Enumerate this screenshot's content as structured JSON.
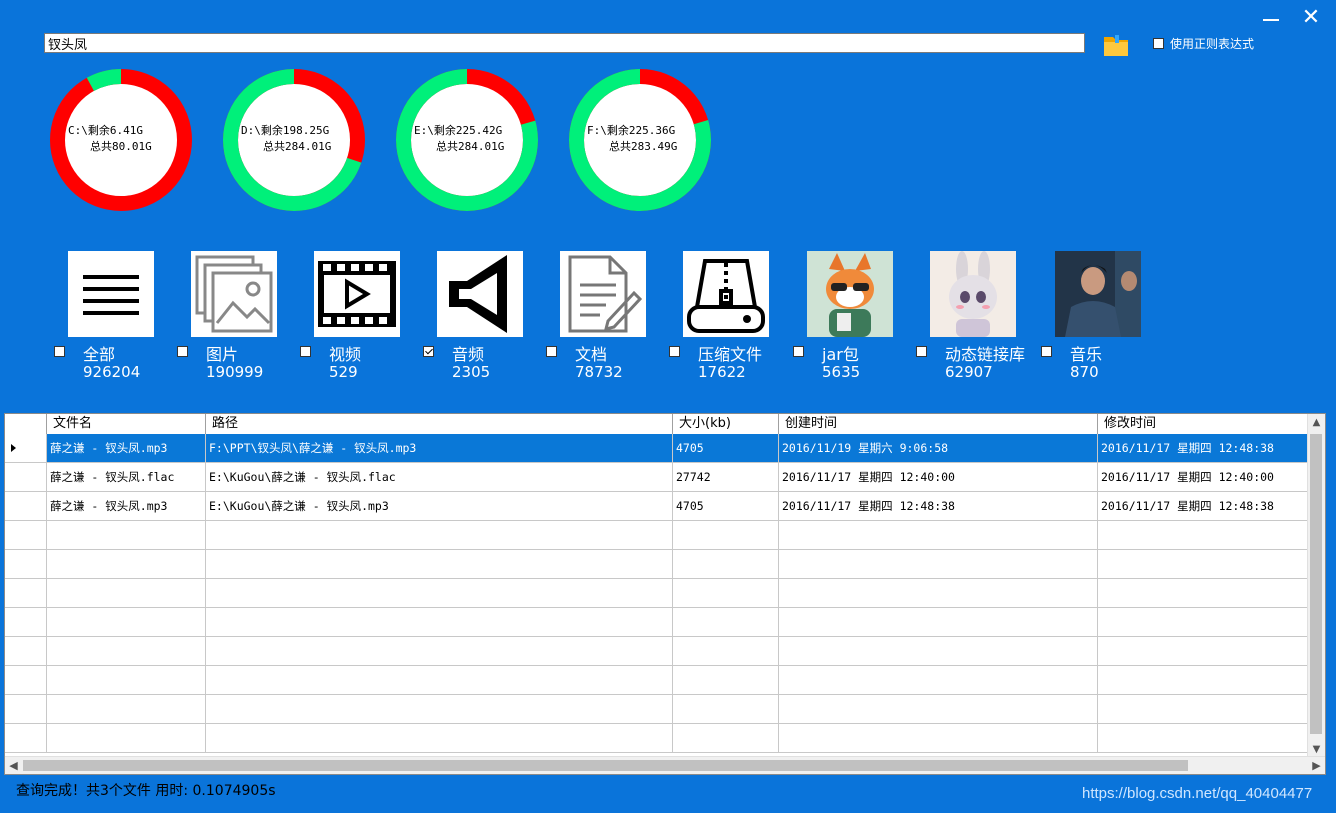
{
  "search": {
    "value": "钗头凤"
  },
  "regex": {
    "label": "使用正则表达式",
    "checked": false
  },
  "disks": [
    {
      "line1": "C:\\剩余6.41G",
      "line2": "总共80.01G",
      "free_fraction": 0.0801
    },
    {
      "line1": "D:\\剩余198.25G",
      "line2": "总共284.01G",
      "free_fraction": 0.698
    },
    {
      "line1": "E:\\剩余225.42G",
      "line2": "总共284.01G",
      "free_fraction": 0.7937
    },
    {
      "line1": "F:\\剩余225.36G",
      "line2": "总共283.49G",
      "free_fraction": 0.795
    }
  ],
  "colors": {
    "used": "#FF0000",
    "free": "#00F07A",
    "background": "#0A74DA",
    "selected_row": "#0A78D7"
  },
  "categories": [
    {
      "label": "全部",
      "count": "926204",
      "icon": "list-icon",
      "checked": false
    },
    {
      "label": "图片",
      "count": "190999",
      "icon": "pictures-icon",
      "checked": false
    },
    {
      "label": "视频",
      "count": "529",
      "icon": "video-icon",
      "checked": false
    },
    {
      "label": "音频",
      "count": "2305",
      "icon": "speaker-icon",
      "checked": true
    },
    {
      "label": "文档",
      "count": "78732",
      "icon": "document-icon",
      "checked": false
    },
    {
      "label": "压缩文件",
      "count": "17622",
      "icon": "archive-icon",
      "checked": false
    },
    {
      "label": "jar包",
      "count": "5635",
      "icon": "fox-avatar-icon",
      "checked": false
    },
    {
      "label": "动态链接库",
      "count": "62907",
      "icon": "rabbit-avatar-icon",
      "checked": false
    },
    {
      "label": "音乐",
      "count": "870",
      "icon": "singer-photo-icon",
      "checked": false
    }
  ],
  "table": {
    "columns": [
      "文件名",
      "路径",
      "大小(kb)",
      "创建时间",
      "修改时间"
    ],
    "rows": [
      [
        "薛之谦 - 钗头凤.mp3",
        "F:\\PPT\\钗头凤\\薛之谦 - 钗头凤.mp3",
        "4705",
        "2016/11/19 星期六 9:06:58",
        "2016/11/17 星期四 12:48:38"
      ],
      [
        "薛之谦 - 钗头凤.flac",
        "E:\\KuGou\\薛之谦 - 钗头凤.flac",
        "27742",
        "2016/11/17 星期四 12:40:00",
        "2016/11/17 星期四 12:40:00"
      ],
      [
        "薛之谦 - 钗头凤.mp3",
        "E:\\KuGou\\薛之谦 - 钗头凤.mp3",
        "4705",
        "2016/11/17 星期四 12:48:38",
        "2016/11/17 星期四 12:48:38"
      ]
    ],
    "selected_row": 0
  },
  "status": {
    "text": "查询完成！共3个文件 用时: 0.1074905s"
  },
  "watermark": "https://blog.csdn.net/qq_40404477"
}
